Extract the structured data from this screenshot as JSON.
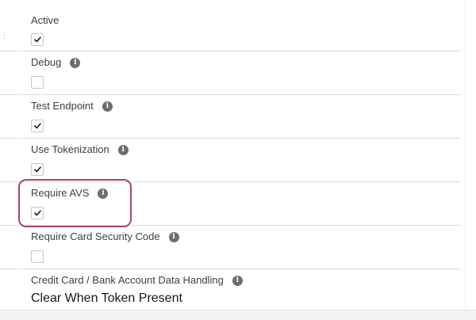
{
  "fields": [
    {
      "label": "Active",
      "has_info": false,
      "type": "checkbox",
      "checked": true
    },
    {
      "label": "Debug",
      "has_info": true,
      "type": "checkbox",
      "checked": false
    },
    {
      "label": "Test Endpoint",
      "has_info": true,
      "type": "checkbox",
      "checked": true
    },
    {
      "label": "Use Tokenization",
      "has_info": true,
      "type": "checkbox",
      "checked": true
    },
    {
      "label": "Require AVS",
      "has_info": true,
      "type": "checkbox",
      "checked": true,
      "highlighted": true
    },
    {
      "label": "Require Card Security Code",
      "has_info": true,
      "type": "checkbox",
      "checked": false
    },
    {
      "label": "Credit Card / Bank Account Data Handling",
      "has_info": true,
      "type": "text",
      "value": "Clear When Token Present"
    }
  ],
  "icons": {
    "info": "info-icon",
    "check": "checkmark-icon"
  },
  "colors": {
    "highlight_border": "#a84672",
    "info_icon": "#706e6b",
    "divider": "#dddbda"
  }
}
